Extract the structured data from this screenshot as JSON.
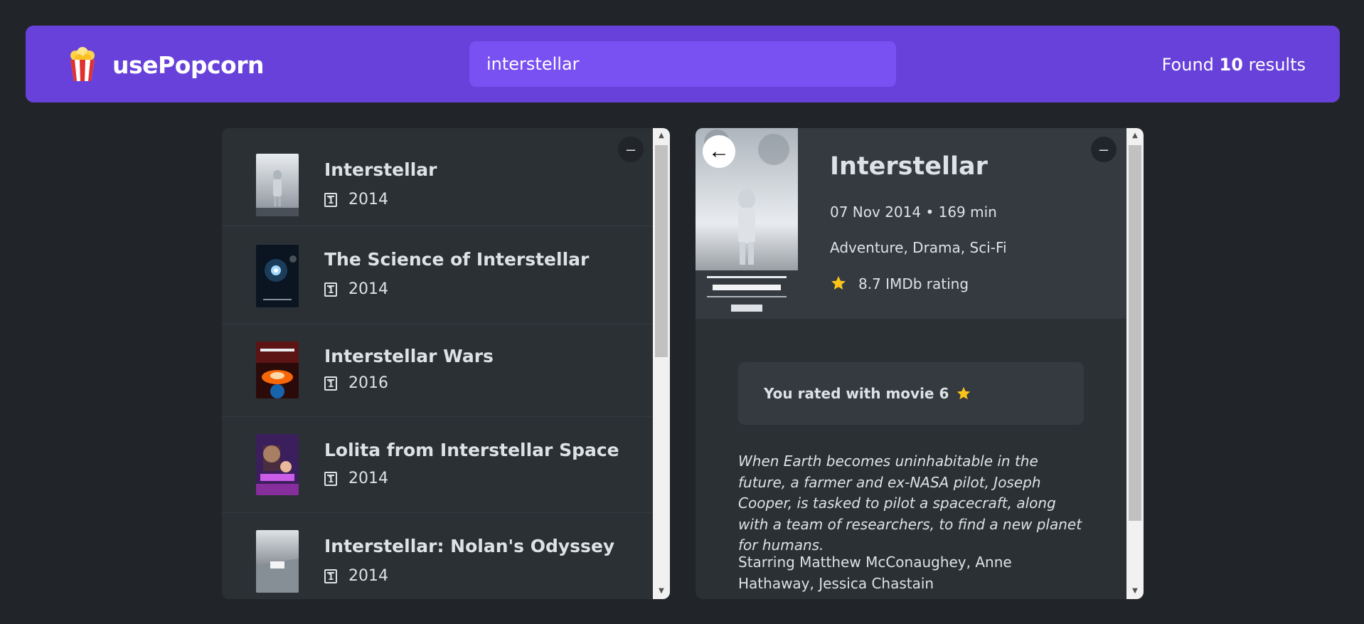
{
  "app": {
    "name": "usePopcorn",
    "logo_icon": "popcorn-icon"
  },
  "search": {
    "value": "interstellar",
    "placeholder": "Search movies..."
  },
  "results": {
    "prefix": "Found",
    "count": "10",
    "suffix": "results"
  },
  "list_box": {
    "toggle_label": "–",
    "movies": [
      {
        "title": "Interstellar",
        "year": "2014"
      },
      {
        "title": "The Science of Interstellar",
        "year": "2014"
      },
      {
        "title": "Interstellar Wars",
        "year": "2016"
      },
      {
        "title": "Lolita from Interstellar Space",
        "year": "2014"
      },
      {
        "title": "Interstellar: Nolan's Odyssey",
        "year": "2014"
      }
    ]
  },
  "details": {
    "toggle_label": "–",
    "back_label": "←",
    "title": "Interstellar",
    "released_runtime": "07 Nov 2014 • 169 min",
    "genres": "Adventure, Drama, Sci-Fi",
    "imdb_rating": "8.7 IMDb rating",
    "user_rating_text": "You rated with movie 6",
    "plot": "When Earth becomes uninhabitable in the future, a farmer and ex-NASA pilot, Joseph Cooper, is tasked to pilot a spacecraft, along with a team of researchers, to find a new planet for humans.",
    "starring": "Starring Matthew McConaughey, Anne Hathaway, Jessica Chastain"
  },
  "colors": {
    "background": "#212529",
    "nav": "#6741d9",
    "search": "#7950f2",
    "box": "#2b3035",
    "box_header": "#343a40",
    "star": "#fcc419"
  }
}
